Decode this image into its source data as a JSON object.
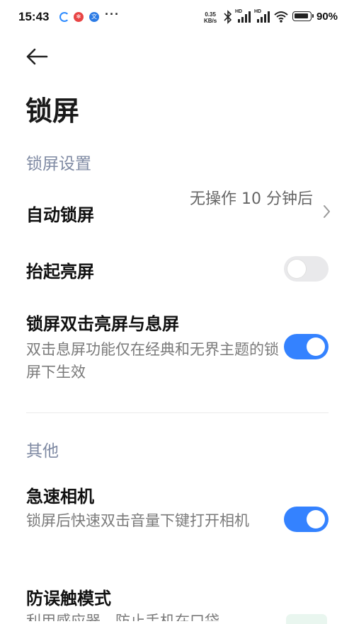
{
  "status_bar": {
    "time": "15:43",
    "notification_icons": [
      "sync-icon",
      "app-icon-red",
      "app-icon-blue"
    ],
    "more_notifications": "···",
    "net_speed_value": "0.35",
    "net_speed_unit": "KB/s",
    "signal_label_1": "HD",
    "signal_label_2": "HD",
    "battery_percent": "90%"
  },
  "header": {
    "back_icon": "arrow-left-icon",
    "title": "锁屏"
  },
  "sections": {
    "lock_settings": {
      "title": "锁屏设置",
      "auto_lock": {
        "title": "自动锁屏",
        "value": "无操作 10 分钟后"
      },
      "raise_to_wake": {
        "title": "抬起亮屏",
        "enabled": false
      },
      "double_tap": {
        "title": "锁屏双击亮屏与息屏",
        "subtitle": "双击息屏功能仅在经典和无界主题的锁屏下生效",
        "enabled": true
      }
    },
    "other": {
      "title": "其他",
      "quick_camera": {
        "title": "急速相机",
        "subtitle": "锁屏后快速双击音量下键打开相机",
        "enabled": true
      },
      "anti_mistouch": {
        "title": "防误触模式",
        "subtitle": "利用感应器，防止手机在口袋"
      }
    }
  },
  "colors": {
    "accent": "#3482ff",
    "section_title": "#7f8aa3",
    "toggle_off": "#e9e9eb"
  }
}
